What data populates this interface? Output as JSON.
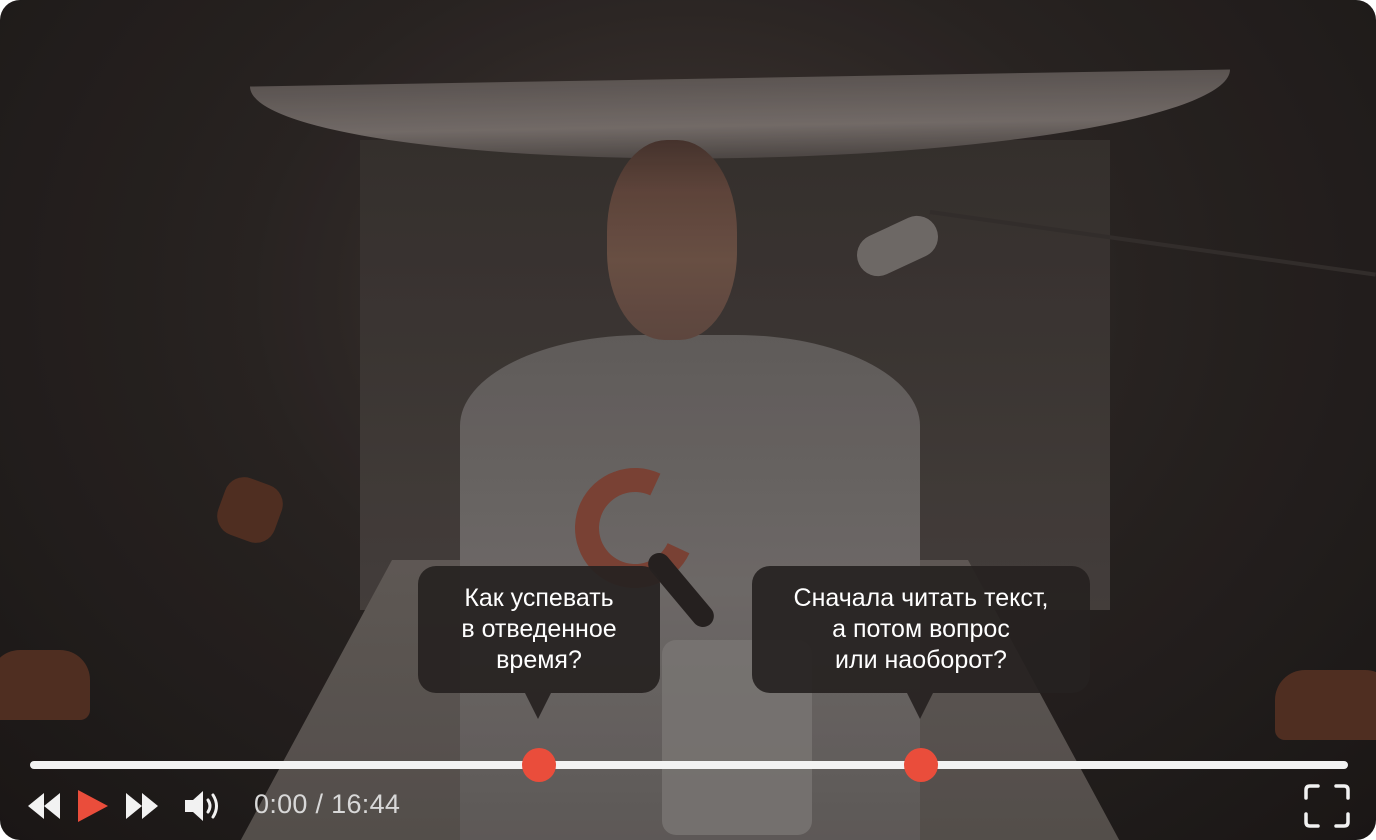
{
  "video": {
    "subject": "presenter-in-studio"
  },
  "tooltips": [
    {
      "lines": [
        "Как успевать",
        "в отведенное",
        "время?"
      ]
    },
    {
      "lines": [
        "Сначала читать текст,",
        "а потом вопрос",
        "или наоборот?"
      ]
    }
  ],
  "progress": {
    "played_fraction": 0.0,
    "chapter_markers_fraction": [
      0.387,
      0.677
    ],
    "track_color": "#f2f2f2",
    "marker_color": "#ea4d3b"
  },
  "controls": {
    "icons": [
      "rewind-icon",
      "play-icon",
      "forward-icon",
      "volume-icon",
      "fullscreen-icon"
    ],
    "time_display": "0:00 / 16:44",
    "accent_color": "#ea4d3b"
  }
}
